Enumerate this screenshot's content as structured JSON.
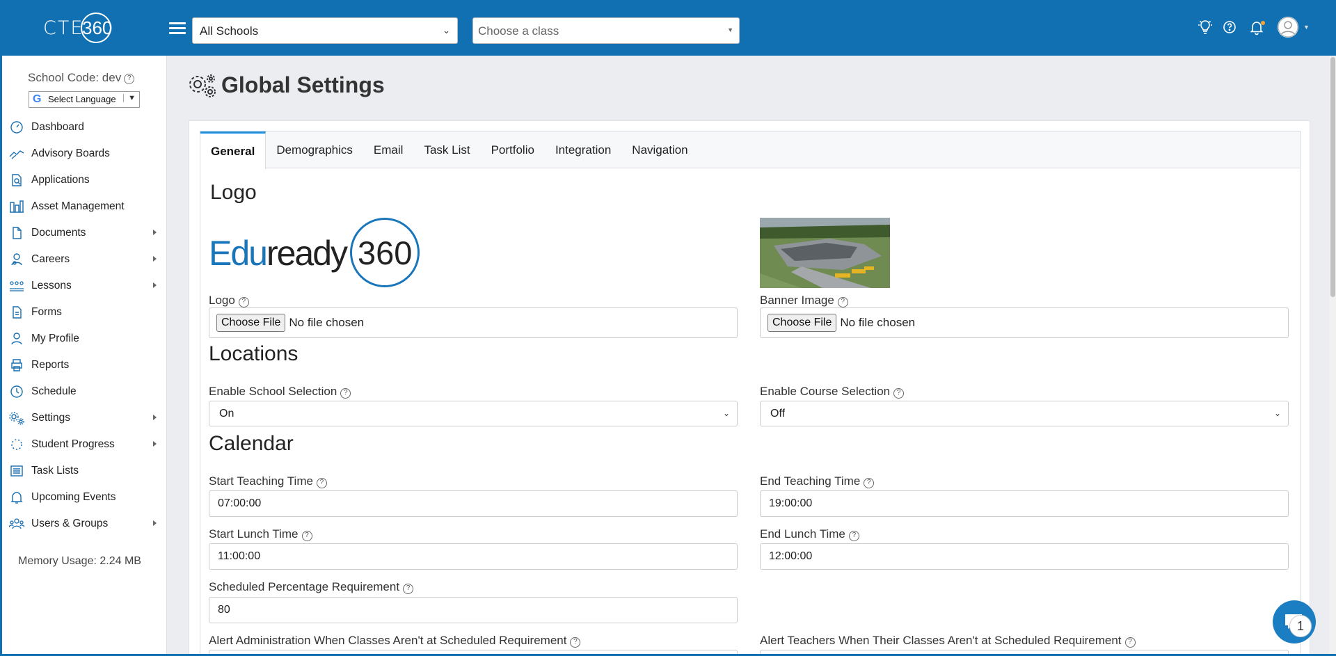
{
  "header": {
    "brand_text": "CTE",
    "brand_number": "360",
    "school_select": "All Schools",
    "class_select_placeholder": "Choose a class"
  },
  "sidebar": {
    "school_code": "School Code: dev",
    "language_label": "Select Language",
    "items": [
      {
        "label": "Dashboard",
        "icon": "dashboard-icon",
        "has_submenu": false
      },
      {
        "label": "Advisory Boards",
        "icon": "handshake-icon",
        "has_submenu": false
      },
      {
        "label": "Applications",
        "icon": "document-search-icon",
        "has_submenu": false
      },
      {
        "label": "Asset Management",
        "icon": "asset-icon",
        "has_submenu": false
      },
      {
        "label": "Documents",
        "icon": "file-icon",
        "has_submenu": true
      },
      {
        "label": "Careers",
        "icon": "career-icon",
        "has_submenu": true
      },
      {
        "label": "Lessons",
        "icon": "lessons-icon",
        "has_submenu": true
      },
      {
        "label": "Forms",
        "icon": "form-icon",
        "has_submenu": false
      },
      {
        "label": "My Profile",
        "icon": "user-icon",
        "has_submenu": false
      },
      {
        "label": "Reports",
        "icon": "printer-icon",
        "has_submenu": false
      },
      {
        "label": "Schedule",
        "icon": "clock-icon",
        "has_submenu": false
      },
      {
        "label": "Settings",
        "icon": "gears-icon",
        "has_submenu": true
      },
      {
        "label": "Student Progress",
        "icon": "progress-icon",
        "has_submenu": true
      },
      {
        "label": "Task Lists",
        "icon": "list-icon",
        "has_submenu": false
      },
      {
        "label": "Upcoming Events",
        "icon": "bell-icon",
        "has_submenu": false
      },
      {
        "label": "Users & Groups",
        "icon": "users-icon",
        "has_submenu": true
      }
    ],
    "memory_usage": "Memory Usage: 2.24 MB"
  },
  "page": {
    "title": "Global Settings",
    "tabs": [
      "General",
      "Demographics",
      "Email",
      "Task List",
      "Portfolio",
      "Integration",
      "Navigation"
    ],
    "active_tab": "General"
  },
  "logo_section": {
    "title": "Logo",
    "logo_brand_prefix": "Edu",
    "logo_brand_word": "ready",
    "logo_brand_number": "360",
    "logo_label": "Logo",
    "banner_label": "Banner Image",
    "choose_file": "Choose File",
    "no_file": "No file chosen"
  },
  "locations": {
    "title": "Locations",
    "school_selection_label": "Enable School Selection",
    "school_selection_value": "On",
    "course_selection_label": "Enable Course Selection",
    "course_selection_value": "Off"
  },
  "calendar": {
    "title": "Calendar",
    "start_teaching_label": "Start Teaching Time",
    "start_teaching_value": "07:00:00",
    "end_teaching_label": "End Teaching Time",
    "end_teaching_value": "19:00:00",
    "start_lunch_label": "Start Lunch Time",
    "start_lunch_value": "11:00:00",
    "end_lunch_label": "End Lunch Time",
    "end_lunch_value": "12:00:00",
    "scheduled_pct_label": "Scheduled Percentage Requirement",
    "scheduled_pct_value": "80",
    "alert_admin_label": "Alert Administration When Classes Aren't at Scheduled Requirement",
    "alert_teachers_label": "Alert Teachers When Their Classes Aren't at Scheduled Requirement"
  },
  "chat": {
    "badge_count": "1"
  },
  "colors": {
    "brand_blue": "#1170b2",
    "tab_accent": "#1e90e0",
    "background": "#ebedf0"
  }
}
